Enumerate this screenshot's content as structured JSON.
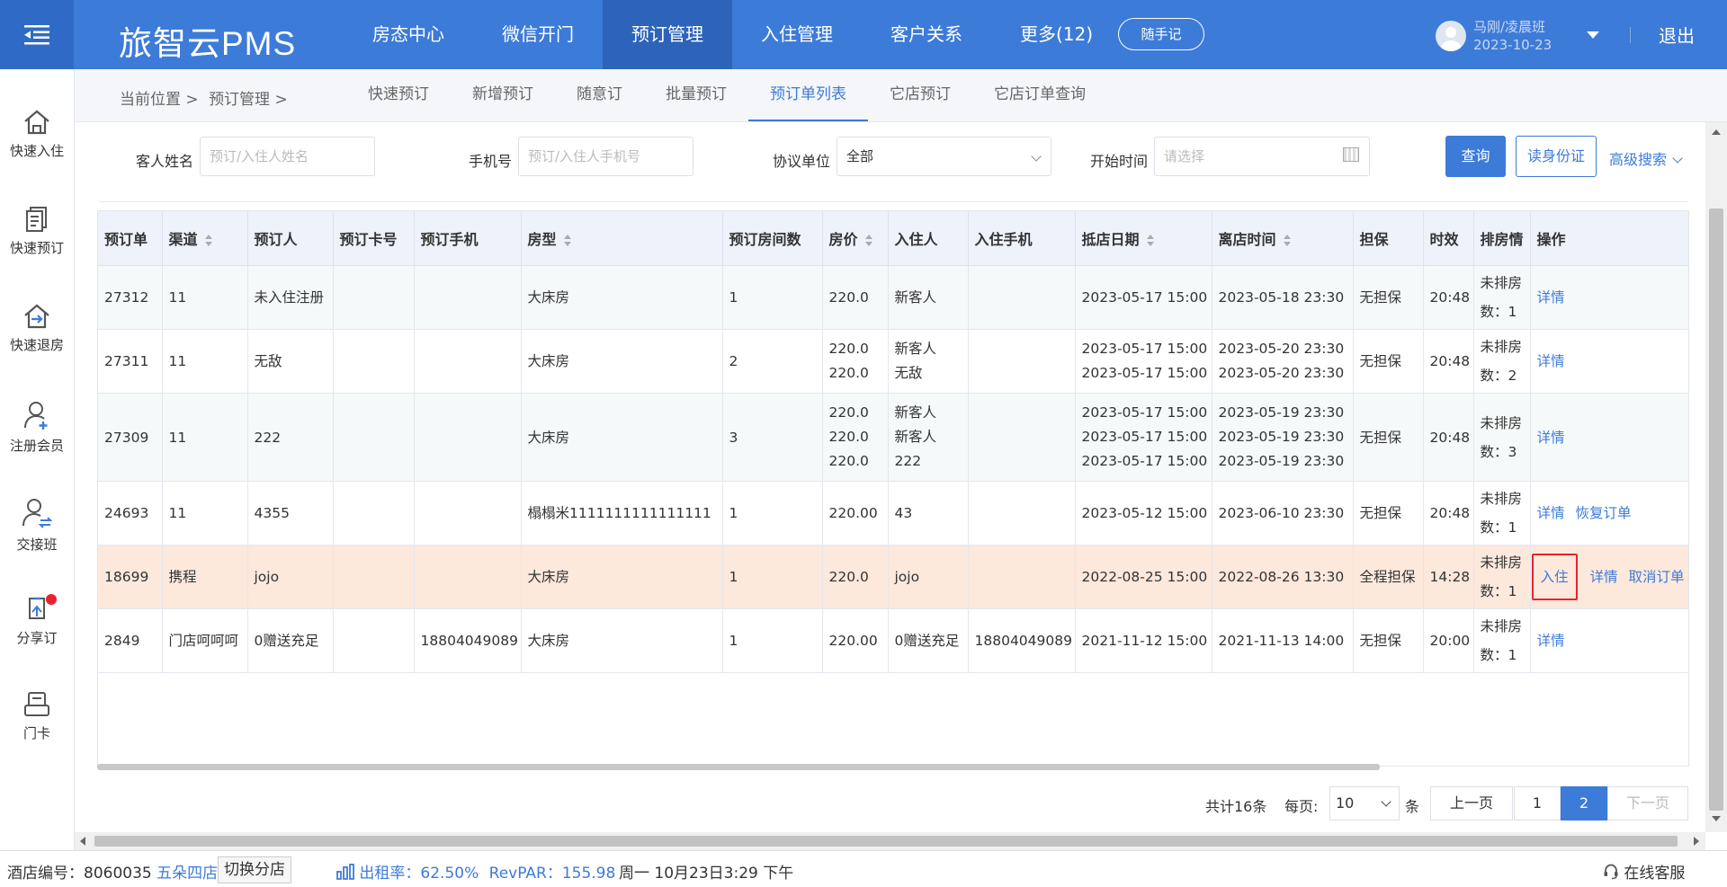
{
  "header": {
    "brand": "旅智云PMS",
    "nav": [
      "房态中心",
      "微信开门",
      "预订管理",
      "入住管理",
      "客户关系",
      "更多(12)"
    ],
    "active_nav": 2,
    "note_button": "随手记",
    "user_name": "马刚/凌晨班",
    "user_date": "2023-10-23",
    "logout": "退出"
  },
  "sidebar": [
    {
      "label": "快速入住",
      "icon": "home-icon"
    },
    {
      "label": "快速预订",
      "icon": "document-icon"
    },
    {
      "label": "快速退房",
      "icon": "checkout-house-icon"
    },
    {
      "label": "注册会员",
      "icon": "add-user-icon"
    },
    {
      "label": "交接班",
      "icon": "shift-swap-icon"
    },
    {
      "label": "分享订",
      "icon": "share-icon"
    },
    {
      "label": "门卡",
      "icon": "card-icon"
    }
  ],
  "breadcrumb": {
    "prefix": "当前位置 >",
    "current": "预订管理 >"
  },
  "tabs": [
    "快速预订",
    "新增预订",
    "随意订",
    "批量预订",
    "预订单列表",
    "它店预订",
    "它店订单查询"
  ],
  "active_tab": 4,
  "filters": {
    "guest_label": "客人姓名",
    "guest_placeholder": "预订/入住人姓名",
    "phone_label": "手机号",
    "phone_placeholder": "预订/入住人手机号",
    "agreement_label": "协议单位",
    "agreement_value": "全部",
    "start_label": "开始时间",
    "start_placeholder": "请选择",
    "query": "查询",
    "id_card": "读身份证",
    "advanced": "高级搜索"
  },
  "table": {
    "columns": [
      "预订单",
      "渠道",
      "预订人",
      "预订卡号",
      "预订手机",
      "房型",
      "预订房间数",
      "房价",
      "入住人",
      "入住手机",
      "抵店日期",
      "离店时间",
      "担保",
      "时效",
      "排房情",
      "操作"
    ],
    "rows": [
      {
        "id": "27312",
        "channel": "11",
        "booker": "未入住注册",
        "card": "",
        "phone": "",
        "room_type": "大床房",
        "rooms": "1",
        "price": [
          "220.0"
        ],
        "guest": [
          "新客人"
        ],
        "guest_phone": "",
        "arrive": [
          "2023-05-17 15:00"
        ],
        "depart": [
          "2023-05-18 23:30"
        ],
        "guarantee": "无担保",
        "timeliness": "20:48",
        "status": "未排房数：1",
        "ops": [
          "详情"
        ]
      },
      {
        "id": "27311",
        "channel": "11",
        "booker": "无敌",
        "card": "",
        "phone": "",
        "room_type": "大床房",
        "rooms": "2",
        "price": [
          "220.0",
          "220.0"
        ],
        "guest": [
          "新客人",
          "无敌"
        ],
        "guest_phone": "",
        "arrive": [
          "2023-05-17 15:00",
          "2023-05-17 15:00"
        ],
        "depart": [
          "2023-05-20 23:30",
          "2023-05-20 23:30"
        ],
        "guarantee": "无担保",
        "timeliness": "20:48",
        "status": "未排房数：2",
        "ops": [
          "详情"
        ]
      },
      {
        "id": "27309",
        "channel": "11",
        "booker": "222",
        "card": "",
        "phone": "",
        "room_type": "大床房",
        "rooms": "3",
        "price": [
          "220.0",
          "220.0",
          "220.0"
        ],
        "guest": [
          "新客人",
          "新客人",
          "222"
        ],
        "guest_phone": "",
        "arrive": [
          "2023-05-17 15:00",
          "2023-05-17 15:00",
          "2023-05-17 15:00"
        ],
        "depart": [
          "2023-05-19 23:30",
          "2023-05-19 23:30",
          "2023-05-19 23:30"
        ],
        "guarantee": "无担保",
        "timeliness": "20:48",
        "status": "未排房数：3",
        "ops": [
          "详情"
        ]
      },
      {
        "id": "24693",
        "channel": "11",
        "booker": "4355",
        "card": "",
        "phone": "",
        "room_type": "榻榻米1111111111111111",
        "rooms": "1",
        "price": [
          "220.00"
        ],
        "guest": [
          "43"
        ],
        "guest_phone": "",
        "arrive": [
          "2023-05-12 15:00"
        ],
        "depart": [
          "2023-06-10 23:30"
        ],
        "guarantee": "无担保",
        "timeliness": "20:48",
        "status": "未排房数：1",
        "ops": [
          "详情",
          "恢复订单"
        ]
      },
      {
        "id": "18699",
        "channel": "携程",
        "booker": "jojo",
        "card": "",
        "phone": "",
        "room_type": "大床房",
        "rooms": "1",
        "price": [
          "220.0"
        ],
        "guest": [
          "jojo"
        ],
        "guest_phone": "",
        "arrive": [
          "2022-08-25 15:00"
        ],
        "depart": [
          "2022-08-26 13:30"
        ],
        "guarantee": "全程担保",
        "timeliness": "14:28",
        "status": "未排房数：1",
        "ops": [
          "入住",
          "详情",
          "取消订单"
        ],
        "highlight": true
      },
      {
        "id": "2849",
        "channel": "门店呵呵呵",
        "booker": "0赠送充足",
        "card": "",
        "phone": "18804049089",
        "room_type": "大床房",
        "rooms": "1",
        "price": [
          "220.00"
        ],
        "guest": [
          "0赠送充足"
        ],
        "guest_phone": "18804049089",
        "arrive": [
          "2021-11-12 15:00"
        ],
        "depart": [
          "2021-11-13 14:00"
        ],
        "guarantee": "无担保",
        "timeliness": "20:00",
        "status": "未排房数：1",
        "ops": [
          "详情"
        ]
      }
    ]
  },
  "pagination": {
    "total": "共计16条",
    "per_page_label": "每页:",
    "per_page": "10",
    "unit": "条",
    "prev": "上一页",
    "pages": [
      "1",
      "2"
    ],
    "current": "2",
    "next": "下一页"
  },
  "statusbar": {
    "hotel_no_label": "酒店编号：",
    "hotel_no": "8060035",
    "branch": "五朵四店",
    "switch": "切换分店",
    "occupancy_label": "出租率：",
    "occupancy": "62.50%",
    "revpar_label": "RevPAR：",
    "revpar": "155.98",
    "datetime": "周一 10月23日3:29 下午",
    "support": "在线客服"
  },
  "colors": {
    "primary": "#3d7bd9",
    "highlight_row": "#fde8dc",
    "alert": "#e8232f"
  }
}
